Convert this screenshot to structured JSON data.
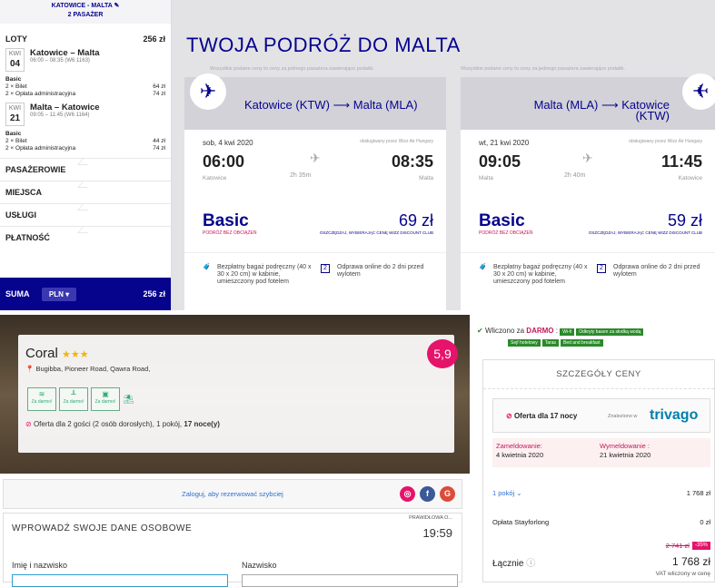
{
  "sidebar": {
    "route": "KATOWICE - MALTA",
    "passengers": "2 PASAŻER",
    "flights_label": "LOTY",
    "flights_total": "256 zł",
    "outbound": {
      "code": "KWI",
      "day": "04",
      "route": "Katowice – Malta",
      "time": "06:00 – 08:35 (W6 1163)"
    },
    "outbound_fare": {
      "name": "Basic",
      "ticket": "2 × Bilet",
      "ticket_price": "64 zł",
      "fee": "2 × Opłata administracyjna",
      "fee_price": "74 zł"
    },
    "inbound": {
      "code": "KWI",
      "day": "21",
      "route": "Malta – Katowice",
      "time": "09:05 – 11:45 (W6 1164)"
    },
    "inbound_fare": {
      "name": "Basic",
      "ticket": "2 × Bilet",
      "ticket_price": "44 zł",
      "fee": "2 × Opłata administracyjna",
      "fee_price": "74 zł"
    },
    "sections": [
      "PASAŻEROWIE",
      "MIEJSCA",
      "USŁUGI",
      "PŁATNOŚĆ"
    ],
    "sum_label": "SUMA",
    "currency": "PLN",
    "sum_total": "256 zł"
  },
  "trip": {
    "title": "TWOJA PODRÓŻ DO MALTA",
    "note": "Wszystkie podane ceny to ceny za jednego pasażera zawierające podatki.",
    "out": {
      "head": "Katowice (KTW) ⟶ Malta (MLA)",
      "date": "sob, 4 kwi 2020",
      "operator": "obsługiwany przez Wizz Air Hungary",
      "dep": "06:00",
      "arr": "08:35",
      "from": "Katowice",
      "to": "Malta",
      "duration": "2h 35m",
      "fare": "Basic",
      "fare_sub": "PODRÓŻ BEZ OBCIĄŻEŃ",
      "price": "69 zł",
      "savings": "OSZCZĘDZAJ, WYBIERAJĄC CENĘ WIZZ DISCOUNT CLUB"
    },
    "ret": {
      "head": "Malta (MLA) ⟶ Katowice (KTW)",
      "date": "wt, 21 kwi 2020",
      "operator": "obsługiwany przez Wizz Air Hungary",
      "dep": "09:05",
      "arr": "11:45",
      "from": "Malta",
      "to": "Katowice",
      "duration": "2h 40m",
      "fare": "Basic",
      "fare_sub": "PODRÓŻ BEZ OBCIĄŻEŃ",
      "price": "59 zł",
      "savings": "OSZCZĘDZAJ, WYBIERAJĄC CENĘ WIZZ DISCOUNT CLUB"
    },
    "bag": "Bezpłatny bagaż podręczny (40 x 30 x 20 cm) w kabinie, umieszczony pod fotelem",
    "checkin": "Odprawa online do 2 dni przed wylotem"
  },
  "hotel": {
    "name": "Coral",
    "stars": "★★★",
    "address": "Bugibba, Pioneer Road, Qawra Road,",
    "amenities": [
      "Za darmo!",
      "Za darmo!",
      "Za darmo!"
    ],
    "offer_text": "Oferta dla 2 gości (2 osób dorosłych), 1 pokój,",
    "nights": "17 noce(y)",
    "score": "5,9"
  },
  "login": "Zaloguj, aby rezerwować szybciej",
  "form": {
    "title": "WPROWADŹ SWOJE DANE OSOBOWE",
    "valid": "PRAWIDŁOWA O...",
    "timer": "19:59",
    "first": "Imię i nazwisko",
    "last": "Nazwisko"
  },
  "free": {
    "label": "Wliczono za",
    "darmo": "DARMO",
    "tags": [
      "Wi-fi",
      "Odkryty basen za słodką wodą",
      "Sejf hotelowy",
      "Taras",
      "Bed and breakfast"
    ]
  },
  "price": {
    "title": "SZCZEGÓŁY CENY",
    "offer": "Oferta dla 17 nocy",
    "found": "Znaleziono w",
    "brand": "trivago",
    "checkin_label": "Zameldowanie:",
    "checkin": "4 kwietnia 2020",
    "checkout_label": "Wymeldowanie :",
    "checkout": "21 kwietnia 2020",
    "rooms": "1 pokój",
    "rooms_price": "1 768 zł",
    "fee_label": "Opłata Stayforlong",
    "fee": "0 zł",
    "old": "2 741 zł",
    "disc": "-35%",
    "total_label": "Łącznie",
    "total": "1 768 zł",
    "vat": "VAT wliczony w cenę"
  }
}
